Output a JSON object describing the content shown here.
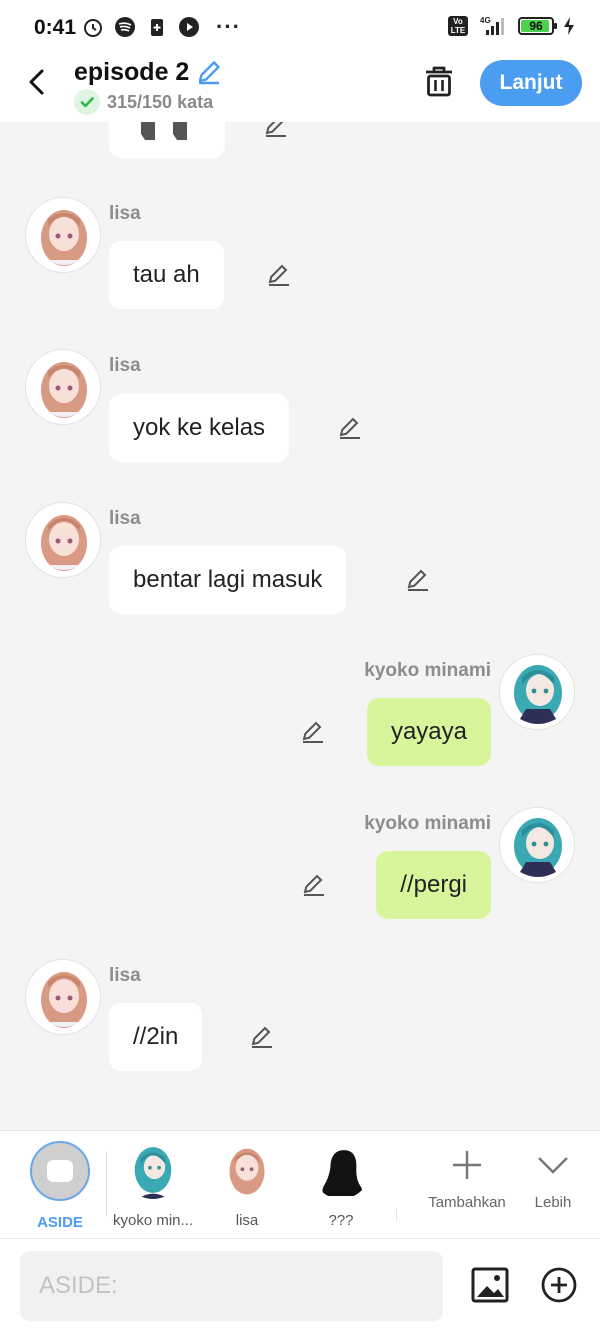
{
  "status_bar": {
    "time": "0:41",
    "network": "4G",
    "volte": "Vo LTE",
    "battery": "96",
    "icons": [
      "alarm-icon",
      "spotify-icon",
      "battery-saver-icon",
      "media-icon",
      "more-icon"
    ]
  },
  "header": {
    "title": "episode 2",
    "word_count": "315/150 kata",
    "next_label": "Lanjut"
  },
  "messages": [
    {
      "speaker": "lisa",
      "text": "tau ah",
      "side": "left"
    },
    {
      "speaker": "lisa",
      "text": "yok ke kelas",
      "side": "left"
    },
    {
      "speaker": "lisa",
      "text": "bentar lagi masuk",
      "side": "left"
    },
    {
      "speaker": "kyoko minami",
      "text": "yayaya",
      "side": "right"
    },
    {
      "speaker": "kyoko minami",
      "text": "//pergi",
      "side": "right"
    },
    {
      "speaker": "lisa",
      "text": "//2in",
      "side": "left"
    }
  ],
  "characters": [
    {
      "label": "ASIDE",
      "selected": true
    },
    {
      "label": "kyoko min..."
    },
    {
      "label": "lisa"
    },
    {
      "label": "???"
    }
  ],
  "actions": {
    "add_label": "Tambahkan",
    "more_label": "Lebih"
  },
  "input": {
    "placeholder": "ASIDE:"
  },
  "colors": {
    "accent": "#4a9df0",
    "my_bubble": "#d7f59a",
    "other_bubble": "#ffffff",
    "background": "#f4f4f4"
  }
}
